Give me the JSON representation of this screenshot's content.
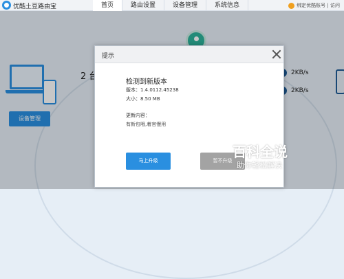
{
  "app": {
    "title": "优酷土豆路由宝",
    "icon": "logo-icon"
  },
  "nav": {
    "items": [
      {
        "label": "首页",
        "active": true
      },
      {
        "label": "路由设置",
        "active": false
      },
      {
        "label": "设备管理",
        "active": false
      },
      {
        "label": "系统信息",
        "active": false
      }
    ]
  },
  "user": {
    "bind_text": "绑定优酷账号 | 访问"
  },
  "dashboard": {
    "device_count": "2 台",
    "device_button": "设备管理",
    "upload_speed": "2KB/s",
    "download_speed": "2KB/s"
  },
  "dialog": {
    "title": "提示",
    "heading": "检测到新版本",
    "version_line": "版本：1.4.0112.45238",
    "size_line": "大小：8.50 MB",
    "update_label": "更新内容：",
    "update_content": "有新包哦,着官慢用",
    "upgrade_button": "马上升级",
    "later_button": "暂不升级"
  },
  "watermark": {
    "main": "百科全说",
    "sub": "助你轻松解决"
  },
  "colors": {
    "accent": "#2a8fe0",
    "dark_blue": "#1e5c96",
    "router_green": "#2eb39a",
    "disabled_gray": "#a3a3a3"
  }
}
